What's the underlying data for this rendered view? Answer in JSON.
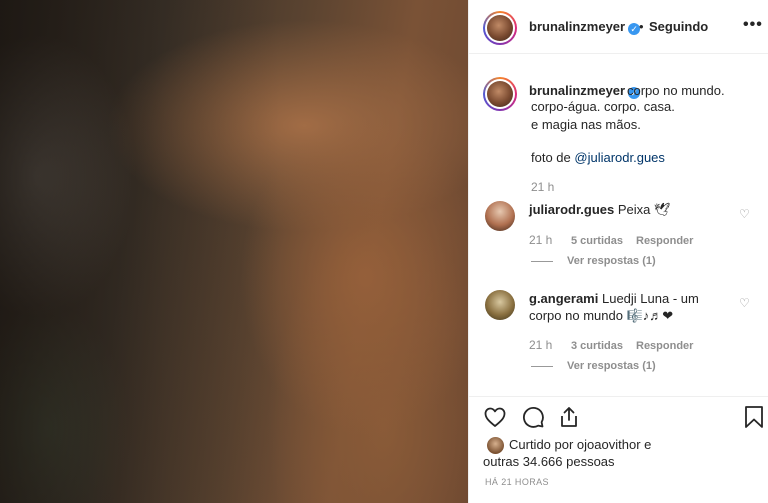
{
  "post": {
    "username": "brunalinzmeyer",
    "verified_mark": "✓",
    "separator": "•",
    "follow_status": "Seguindo",
    "more_label": "•••",
    "caption_lines": [
      "corpo no mundo.",
      "corpo-água. corpo. casa.",
      "e magia nas mãos."
    ],
    "photo_credit_prefix": "foto de ",
    "photo_credit_mention": "@juliarodr.gues",
    "caption_time": "21 h"
  },
  "comments": [
    {
      "username": "juliarodr.gues",
      "text": "Peixa 🕊",
      "time": "21 h",
      "likes": "5 curtidas",
      "reply_label": "Responder",
      "replies_label": "Ver respostas (1)"
    },
    {
      "username": "g.angerami",
      "text_line1": "Luedji Luna - um",
      "text_line2": "corpo no mundo 🎼♪♬❤",
      "time": "21 h",
      "likes": "3 curtidas",
      "reply_label": "Responder",
      "replies_label": "Ver respostas (1)"
    }
  ],
  "likes": {
    "line1": "Curtido por ojoaovithor e",
    "line2": "outras 34.666 pessoas"
  },
  "posted_ago": "HÁ 21 HORAS",
  "icons": {
    "like": "heart-icon",
    "comment": "comment-icon",
    "share": "share-icon",
    "save": "bookmark-icon"
  },
  "colors": {
    "verified": "#3897f0",
    "mention": "#003569",
    "muted": "#8e8e8e",
    "text": "#262626"
  }
}
